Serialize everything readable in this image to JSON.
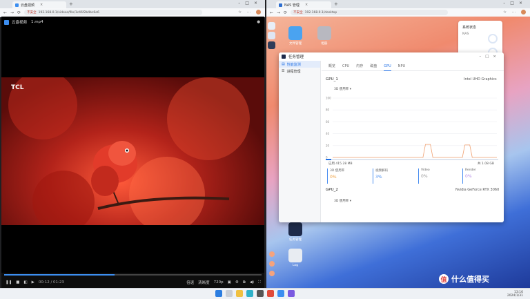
{
  "left_browser": {
    "tab_title": "云盘视频",
    "url": "192.168.0.1/videos/file/1c46f2b4bc6e6",
    "security_label": "不安全",
    "player": {
      "app_name": "云盘视频",
      "filename": "1.mp4",
      "watermark": "TCL",
      "time": "00:12 / 01:23",
      "progress": 0.43,
      "controls": [
        "倍速",
        "清晰度",
        "720p"
      ]
    }
  },
  "right_browser": {
    "tab_title": "NAS 管理",
    "url": "192.168.0.1/desktop",
    "security_label": "不安全"
  },
  "desktop": {
    "icons": [
      {
        "label": "文件管理"
      },
      {
        "label": "相册"
      },
      {
        "label": "任务管理"
      },
      {
        "label": "Log"
      }
    ],
    "widgets": {
      "title": "系统状态",
      "sub": "NAS"
    }
  },
  "task_manager": {
    "title": "任务管理",
    "sidebar": [
      "性能监测",
      "进程管理"
    ],
    "tabs": [
      "概览",
      "CPU",
      "内存",
      "磁盘",
      "GPU",
      "NPU"
    ],
    "active_tab": "GPU",
    "gpu1": {
      "name": "GPU_1",
      "model": "Intel UHD Graphics",
      "dropdown": "3D 使用率",
      "y_ticks": [
        "100",
        "80",
        "60",
        "40",
        "20",
        "0"
      ],
      "stats": [
        {
          "label": "3D 使用率",
          "value": "0%"
        },
        {
          "label": "视频解码",
          "value": "3%"
        },
        {
          "label": "Video",
          "value": "0%"
        },
        {
          "label": "Render",
          "value": "0%"
        }
      ],
      "legend_left": "已用 415.28 MB",
      "legend_right": "共 1.08 GB"
    },
    "gpu2": {
      "name": "GPU_2",
      "model": "Nvidia GeForce RTX 3060",
      "dropdown": "3D 使用率"
    }
  },
  "taskbar": {
    "time": "13:16",
    "date": "2024/1/31"
  },
  "watermark": {
    "text": "什么值得买"
  },
  "chart_data": {
    "type": "area",
    "title": "GPU_1",
    "ylim": [
      0,
      100
    ],
    "x": [
      0,
      5,
      10,
      15,
      20,
      25,
      30,
      35,
      40,
      45,
      50,
      55,
      60,
      65,
      70,
      75,
      80,
      85,
      90,
      95,
      100
    ],
    "series": [
      {
        "values": [
          0,
          0,
          0,
          0,
          0,
          0,
          0,
          0,
          0,
          0,
          0,
          0,
          0,
          0,
          0,
          0,
          0,
          0,
          0,
          0,
          0
        ]
      },
      {
        "values": [
          0,
          0,
          0,
          0,
          0,
          0,
          0,
          0,
          0,
          0,
          0,
          0,
          0,
          0,
          0,
          0,
          0,
          0,
          0,
          0,
          0
        ]
      }
    ],
    "spikes": [
      {
        "x": 58,
        "peak": 22
      },
      {
        "x": 82,
        "peak": 21
      }
    ]
  }
}
